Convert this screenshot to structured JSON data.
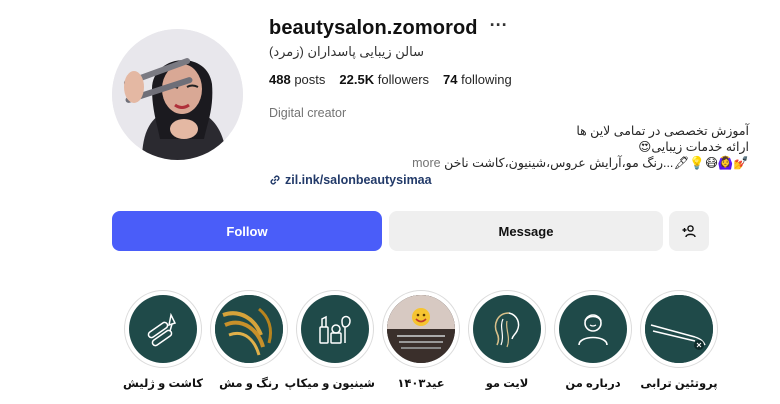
{
  "profile": {
    "username": "beautysalon.zomorod",
    "options_icon": "more-dots-icon",
    "full_name": "سالن زیبایی پاسداران (زمرد)",
    "stats": {
      "posts_count": "488",
      "posts_label": "posts",
      "followers_count": "22.5K",
      "followers_label": "followers",
      "following_count": "74",
      "following_label": "following"
    },
    "category": "Digital creator",
    "bio": {
      "line1": "آموزش تخصصی در تمامی لاین ها",
      "line2": "ارائه خدمات زیبایی😍",
      "line3": "💅🙆‍♀️😷💡🖋...رنگ مو،آرایش عروس،شینیون،کاشت ناخن",
      "more_label": "more"
    },
    "link": "zil.ink/salonbeautysimaa"
  },
  "actions": {
    "follow_label": "Follow",
    "message_label": "Message",
    "add_user_icon": "add-user-icon"
  },
  "highlights": [
    {
      "label": "کاشت و ژلیش",
      "icon": "nail-icon"
    },
    {
      "label": "رنگ و مش",
      "icon": "hair-color-icon"
    },
    {
      "label": "شینیون و میکاپ",
      "icon": "makeup-icon"
    },
    {
      "label": "عید۱۴۰۳",
      "icon": "eid-photo-icon"
    },
    {
      "label": "لایت مو",
      "icon": "hair-light-icon"
    },
    {
      "label": "درباره من",
      "icon": "about-me-icon"
    },
    {
      "label": "پروتئین ترابی",
      "icon": "hair-straightener-icon"
    }
  ],
  "colors": {
    "follow_button": "#4a5df9",
    "secondary_button": "#efefef",
    "highlight_bg": "#1f4a49",
    "link": "#223a69"
  }
}
